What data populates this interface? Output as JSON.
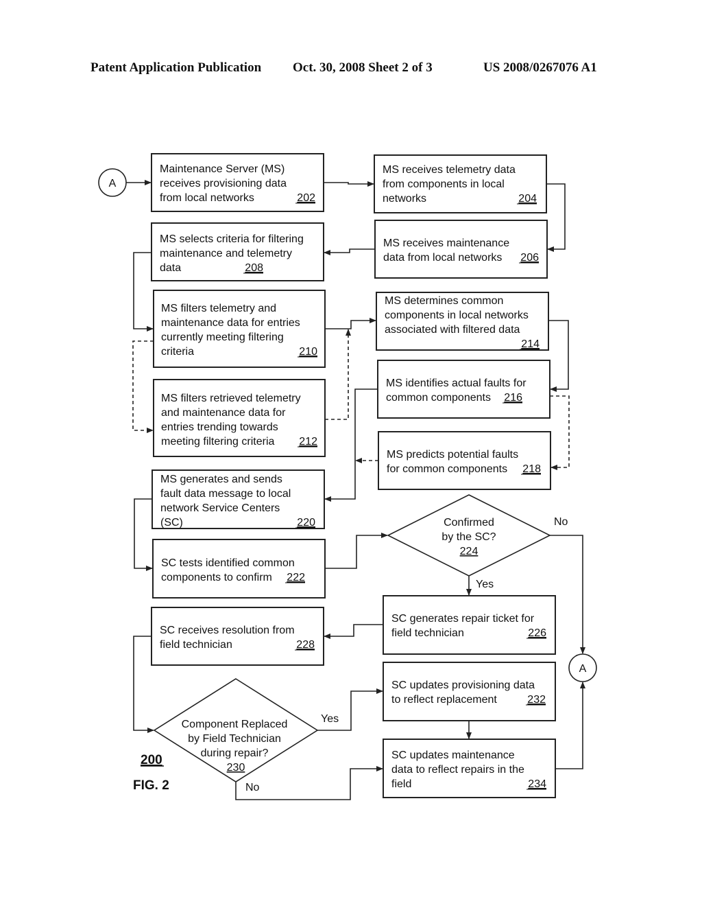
{
  "header": {
    "publication": "Patent Application Publication",
    "date_sheet": "Oct. 30, 2008   Sheet 2 of 3",
    "number": "US 2008/0267076 A1"
  },
  "figure": {
    "ref": "200",
    "label": "FIG. 2"
  },
  "connectors": {
    "start": "A",
    "end": "A"
  },
  "nodes": {
    "n202": {
      "lines": [
        "Maintenance Server (MS)",
        "receives provisioning data",
        "from local networks"
      ],
      "ref": "202"
    },
    "n204": {
      "lines": [
        "MS receives telemetry data",
        "from components in local",
        "networks"
      ],
      "ref": "204"
    },
    "n206": {
      "lines": [
        "MS receives maintenance",
        "data from local networks"
      ],
      "ref": "206"
    },
    "n208": {
      "lines": [
        "MS selects criteria for filtering",
        "maintenance and telemetry",
        "data"
      ],
      "ref": "208"
    },
    "n210": {
      "lines": [
        "MS filters telemetry and",
        "maintenance data for entries",
        "currently meeting filtering",
        "criteria"
      ],
      "ref": "210"
    },
    "n212": {
      "lines": [
        "MS filters retrieved telemetry",
        "and maintenance data for",
        "entries trending towards",
        "meeting filtering criteria"
      ],
      "ref": "212"
    },
    "n214": {
      "lines": [
        "MS determines common",
        "components in local networks",
        "associated with filtered data"
      ],
      "ref": "214"
    },
    "n216": {
      "lines": [
        "MS identifies actual faults for",
        "common components"
      ],
      "ref": "216"
    },
    "n218": {
      "lines": [
        "MS predicts potential faults",
        "for common components"
      ],
      "ref": "218"
    },
    "n220": {
      "lines": [
        "MS generates and sends",
        "fault data message to local",
        "network Service Centers",
        "(SC)"
      ],
      "ref": "220"
    },
    "n222": {
      "lines": [
        "SC tests identified common",
        "components to confirm"
      ],
      "ref": "222"
    },
    "n224": {
      "lines": [
        "Confirmed",
        "by the SC?"
      ],
      "ref": "224",
      "yes": "Yes",
      "no": "No"
    },
    "n226": {
      "lines": [
        "SC generates repair ticket for",
        "field technician"
      ],
      "ref": "226"
    },
    "n228": {
      "lines": [
        "SC receives resolution from",
        "field technician"
      ],
      "ref": "228"
    },
    "n230": {
      "lines": [
        "Component Replaced",
        "by Field Technician",
        "during repair?"
      ],
      "ref": "230",
      "yes": "Yes",
      "no": "No"
    },
    "n232": {
      "lines": [
        "SC updates provisioning data",
        "to reflect replacement"
      ],
      "ref": "232"
    },
    "n234": {
      "lines": [
        "SC updates maintenance",
        "data to reflect repairs in the",
        "field"
      ],
      "ref": "234"
    }
  }
}
